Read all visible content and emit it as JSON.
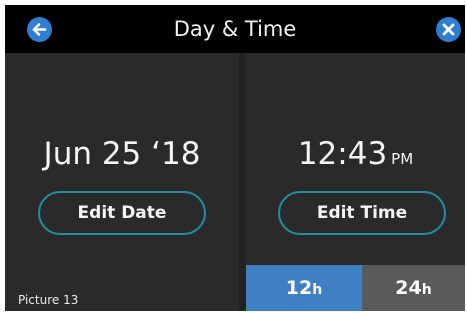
{
  "header": {
    "title": "Day & Time",
    "back_icon": "arrow-left-icon",
    "close_icon": "close-icon",
    "accent_color": "#2e7fd2"
  },
  "date_panel": {
    "date": "Jun 25 ‘18",
    "edit_label": "Edit Date"
  },
  "time_panel": {
    "time": "12:43",
    "period": "PM",
    "edit_label": "Edit Time"
  },
  "format_toggle": {
    "option_12_number": "12",
    "option_12_unit": "h",
    "option_24_number": "24",
    "option_24_unit": "h",
    "selected": "12h",
    "selected_color": "#3f7fc4",
    "unselected_color": "#5a5a5a"
  },
  "caption": "Picture 13"
}
